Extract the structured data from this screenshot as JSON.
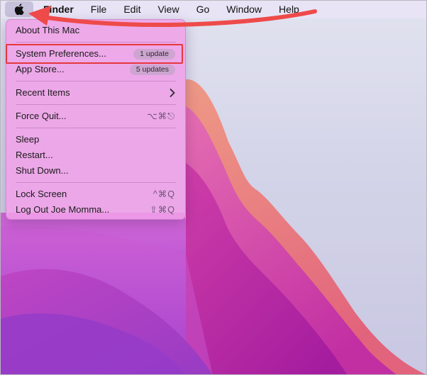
{
  "menubar": {
    "apple_icon": "apple-logo-icon",
    "items": [
      "Finder",
      "File",
      "Edit",
      "View",
      "Go",
      "Window",
      "Help"
    ]
  },
  "apple_menu": {
    "about": "About This Mac",
    "system_preferences": {
      "label": "System Preferences...",
      "badge": "1 update"
    },
    "app_store": {
      "label": "App Store...",
      "badge": "5 updates"
    },
    "recent_items": {
      "label": "Recent Items",
      "icon": "chevron-right-icon"
    },
    "force_quit": {
      "label": "Force Quit...",
      "shortcut": "⌥⌘⎋"
    },
    "sleep": "Sleep",
    "restart": "Restart...",
    "shut_down": "Shut Down...",
    "lock_screen": {
      "label": "Lock Screen",
      "shortcut": "^⌘Q"
    },
    "log_out": {
      "label": "Log Out Joe Momma...",
      "shortcut": "⇧⌘Q"
    }
  },
  "annotations": {
    "highlight_color": "#e5373e",
    "arrow_color": "#ee4a4a"
  },
  "colors": {
    "menu_background": "#f0a0e8",
    "wallpaper_magenta": "#c62ea8",
    "wallpaper_orange": "#e5857b",
    "wallpaper_purple": "#6a22c0"
  }
}
